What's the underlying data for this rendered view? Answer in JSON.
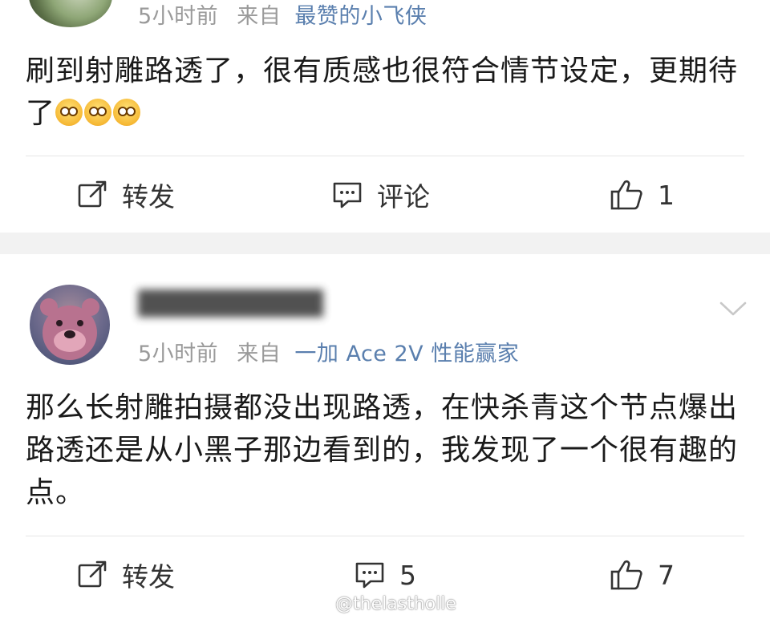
{
  "posts": [
    {
      "meta": {
        "time": "5小时前",
        "from_prefix": "来自",
        "source": "最赞的小飞侠"
      },
      "content_text": "刷到射雕路透了，很有质感也很符合情节设定，更期待了",
      "emoji_name": "scream-emoji",
      "emoji_count": 3,
      "actions": {
        "repost": "转发",
        "comment": "评论",
        "like": "1"
      }
    },
    {
      "username": "██████████",
      "meta": {
        "time": "5小时前",
        "from_prefix": "来自",
        "source": "一加 Ace 2V 性能赢家"
      },
      "content_text": "那么长射雕拍摄都没出现路透，在快杀青这个节点爆出路透还是从小黑子那边看到的，我发现了一个很有趣的点。",
      "actions": {
        "repost": "转发",
        "comment": "5",
        "like": "7"
      }
    }
  ],
  "watermark": "@thelastholle",
  "colors": {
    "source_link": "#5a7fae",
    "meta_gray": "#9a9a9a",
    "background": "#f2f2f2"
  }
}
